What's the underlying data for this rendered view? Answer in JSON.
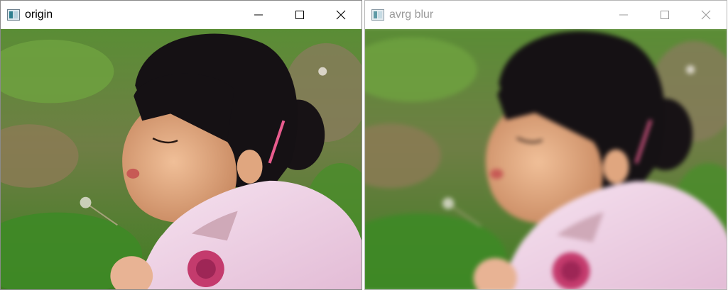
{
  "windows": [
    {
      "title": "origin",
      "active": true
    },
    {
      "title": "avrg blur",
      "active": false
    }
  ],
  "icons": {
    "app": "opencv-window-icon",
    "minimize": "minimize-icon",
    "maximize": "maximize-icon",
    "close": "close-icon"
  },
  "colors": {
    "active_title": "#000000",
    "inactive_title": "#9a9a9a",
    "grass": "#4f8a2e",
    "shirt": "#f1d6ea",
    "hair": "#151114"
  }
}
